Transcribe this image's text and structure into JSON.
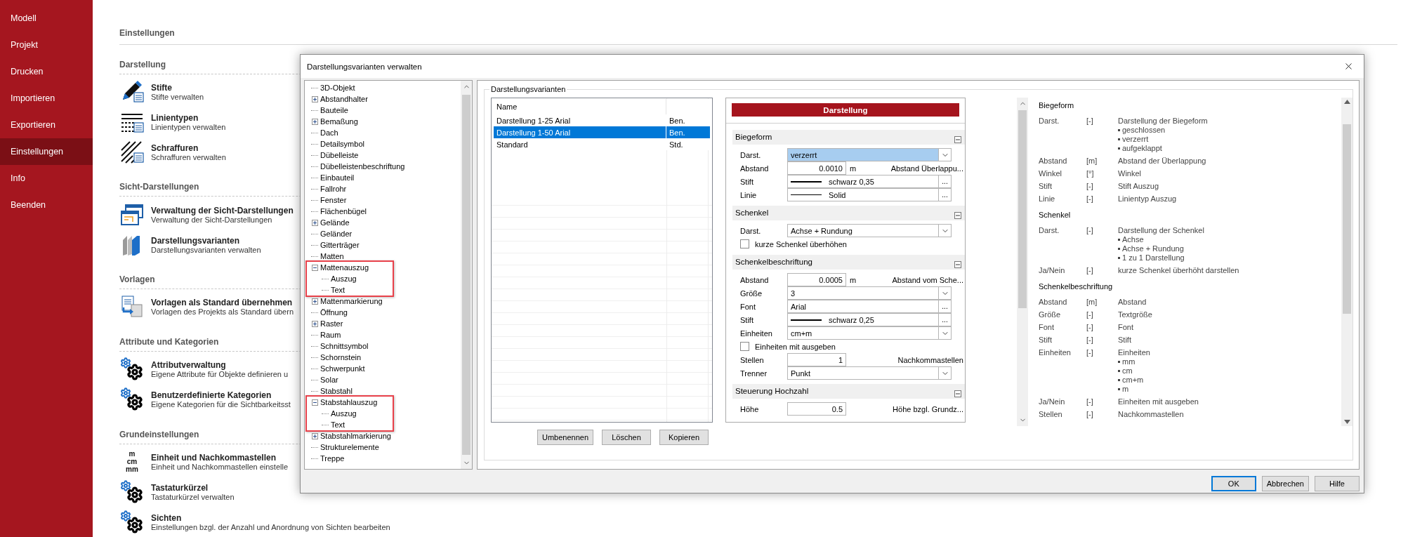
{
  "sidebar": {
    "items": [
      {
        "label": "Modell",
        "selected": false
      },
      {
        "label": "Projekt",
        "selected": false
      },
      {
        "label": "Drucken",
        "selected": false
      },
      {
        "label": "Importieren",
        "selected": false
      },
      {
        "label": "Exportieren",
        "selected": false
      },
      {
        "label": "Einstellungen",
        "selected": true
      },
      {
        "label": "Info",
        "selected": false
      },
      {
        "label": "Beenden",
        "selected": false
      }
    ]
  },
  "settings": {
    "title": "Einstellungen",
    "sections": [
      {
        "title": "Darstellung",
        "items": [
          {
            "kind": "pen",
            "title": "Stifte",
            "subtitle": "Stifte verwalten"
          },
          {
            "kind": "linetypes",
            "title": "Linientypen",
            "subtitle": "Linientypen verwalten"
          },
          {
            "kind": "hatch",
            "title": "Schraffuren",
            "subtitle": "Schraffuren verwalten"
          }
        ]
      },
      {
        "title": "Sicht-Darstellungen",
        "items": [
          {
            "kind": "views",
            "title": "Verwaltung der Sicht-Darstellungen",
            "subtitle": "Verwaltung der Sicht-Darstellungen"
          },
          {
            "kind": "books",
            "title": "Darstellungsvarianten",
            "subtitle": "Darstellungsvarianten verwalten"
          }
        ]
      },
      {
        "title": "Vorlagen",
        "items": [
          {
            "kind": "template",
            "title": "Vorlagen als Standard übernehmen",
            "subtitle": "Vorlagen des Projekts als Standard übern"
          }
        ]
      },
      {
        "title": "Attribute und Kategorien",
        "items": [
          {
            "kind": "gears",
            "title": "Attributverwaltung",
            "subtitle": "Eigene Attribute für Objekte definieren u"
          },
          {
            "kind": "gears",
            "title": "Benutzerdefinierte Kategorien",
            "subtitle": "Eigene Kategorien für die Sichtbarkeitsst"
          }
        ]
      },
      {
        "title": "Grundeinstellungen",
        "items": [
          {
            "kind": "units",
            "icon_lines": [
              "m",
              "cm",
              "mm"
            ],
            "title": "Einheit und Nachkommastellen",
            "subtitle": "Einheit und Nachkommastellen einstelle"
          },
          {
            "kind": "gears",
            "title": "Tastaturkürzel",
            "subtitle": "Tastaturkürzel verwalten"
          },
          {
            "kind": "gears",
            "title": "Sichten",
            "subtitle": "Einstellungen bzgl. der Anzahl und Anordnung von Sichten bearbeiten"
          }
        ]
      }
    ]
  },
  "dialog": {
    "title": "Darstellungsvarianten verwalten",
    "tree": {
      "items": [
        {
          "label": "3D-Objekt",
          "kind": "leaf",
          "highlighted": false
        },
        {
          "label": "Abstandhalter",
          "kind": "group",
          "expanded": false,
          "highlighted": false
        },
        {
          "label": "Bauteile",
          "kind": "leaf",
          "highlighted": false
        },
        {
          "label": "Bemaßung",
          "kind": "group",
          "expanded": false,
          "highlighted": false
        },
        {
          "label": "Dach",
          "kind": "leaf",
          "highlighted": false
        },
        {
          "label": "Detailsymbol",
          "kind": "leaf",
          "highlighted": false
        },
        {
          "label": "Dübelleiste",
          "kind": "leaf",
          "highlighted": false
        },
        {
          "label": "Dübelleistenbeschriftung",
          "kind": "leaf",
          "highlighted": false
        },
        {
          "label": "Einbauteil",
          "kind": "leaf",
          "highlighted": false
        },
        {
          "label": "Fallrohr",
          "kind": "leaf",
          "highlighted": false
        },
        {
          "label": "Fenster",
          "kind": "leaf",
          "highlighted": false
        },
        {
          "label": "Flächenbügel",
          "kind": "leaf",
          "highlighted": false
        },
        {
          "label": "Gelände",
          "kind": "group",
          "expanded": false,
          "highlighted": false
        },
        {
          "label": "Geländer",
          "kind": "leaf",
          "highlighted": false
        },
        {
          "label": "Gitterträger",
          "kind": "leaf",
          "highlighted": false
        },
        {
          "label": "Matten",
          "kind": "leaf",
          "highlighted": false
        },
        {
          "label": "Mattenauszug",
          "kind": "group",
          "expanded": true,
          "highlighted": true,
          "children": [
            {
              "label": "Auszug"
            },
            {
              "label": "Text"
            }
          ]
        },
        {
          "label": "Mattenmarkierung",
          "kind": "group",
          "expanded": false,
          "highlighted": false
        },
        {
          "label": "Öffnung",
          "kind": "leaf",
          "highlighted": false
        },
        {
          "label": "Raster",
          "kind": "group",
          "expanded": false,
          "highlighted": false
        },
        {
          "label": "Raum",
          "kind": "leaf",
          "highlighted": false
        },
        {
          "label": "Schnittsymbol",
          "kind": "leaf",
          "highlighted": false
        },
        {
          "label": "Schornstein",
          "kind": "leaf",
          "highlighted": false
        },
        {
          "label": "Schwerpunkt",
          "kind": "leaf",
          "highlighted": false
        },
        {
          "label": "Solar",
          "kind": "leaf",
          "highlighted": false
        },
        {
          "label": "Stabstahl",
          "kind": "leaf",
          "highlighted": false
        },
        {
          "label": "Stabstahlauszug",
          "kind": "group",
          "expanded": true,
          "highlighted": true,
          "children": [
            {
              "label": "Auszug"
            },
            {
              "label": "Text"
            }
          ]
        },
        {
          "label": "Stabstahlmarkierung",
          "kind": "group",
          "expanded": false,
          "highlighted": false
        },
        {
          "label": "Strukturelemente",
          "kind": "leaf",
          "highlighted": false
        },
        {
          "label": "Treppe",
          "kind": "leaf",
          "highlighted": false
        }
      ]
    },
    "variants": {
      "group_title": "Darstellungsvarianten",
      "columns": [
        "Name"
      ],
      "rows": [
        {
          "name": "Darstellung 1-25 Arial",
          "column_2": "Ben.",
          "selected": false
        },
        {
          "name": "Darstellung 1-50 Arial",
          "column_2": "Ben.",
          "selected": true
        },
        {
          "name": "Standard",
          "column_2": "Std.",
          "selected": false
        }
      ],
      "buttons": [
        "Umbenennen",
        "Löschen",
        "Kopieren"
      ]
    },
    "properties": {
      "header": "Darstellung",
      "sections": [
        {
          "title": "Biegeform",
          "expanded": true,
          "rows": [
            {
              "kind": "select",
              "label": "Darst.",
              "value": "verzerrt",
              "focused": true
            },
            {
              "kind": "number",
              "label": "Abstand",
              "value": "0.0010",
              "unit": "m",
              "note": "Abstand Überlappu..."
            },
            {
              "kind": "pen",
              "label": "Stift",
              "value": "schwarz 0,35",
              "button": "..."
            },
            {
              "kind": "line",
              "label": "Linie",
              "value": "Solid",
              "button": "..."
            }
          ]
        },
        {
          "title": "Schenkel",
          "expanded": true,
          "rows": [
            {
              "kind": "select",
              "label": "Darst.",
              "value": "Achse + Rundung",
              "focused": false
            },
            {
              "kind": "checkbox",
              "label": "kurze Schenkel überhöhen",
              "checked": false
            }
          ]
        },
        {
          "title": "Schenkelbeschriftung",
          "expanded": true,
          "rows": [
            {
              "kind": "number",
              "label": "Abstand",
              "value": "0.0005",
              "unit": "m",
              "note": "Abstand vom Sche..."
            },
            {
              "kind": "select",
              "label": "Größe",
              "value": "3",
              "focused": false
            },
            {
              "kind": "browse",
              "label": "Font",
              "value": "Arial",
              "button": "..."
            },
            {
              "kind": "pen",
              "label": "Stift",
              "value": "schwarz 0,25",
              "button": "..."
            },
            {
              "kind": "select",
              "label": "Einheiten",
              "value": "cm+m",
              "focused": false
            },
            {
              "kind": "checkbox",
              "label": "Einheiten mit ausgeben",
              "checked": false
            },
            {
              "kind": "number",
              "label": "Stellen",
              "value": "1",
              "note": "Nachkommastellen"
            },
            {
              "kind": "select",
              "label": "Trenner",
              "value": "Punkt",
              "focused": false
            }
          ]
        },
        {
          "title": "Steuerung Hochzahl",
          "expanded": true,
          "rows": [
            {
              "kind": "number",
              "label": "Höhe",
              "value": "0.5",
              "note": "Höhe bzgl. Grundz..."
            }
          ]
        }
      ]
    },
    "help": {
      "sections": [
        {
          "title": "Biegeform",
          "rows": [
            {
              "name": "Darst.",
              "unit": "[-]",
              "description": "Darstellung der Biegeform",
              "bullets": [
                "geschlossen",
                "verzerrt",
                "aufgeklappt"
              ]
            },
            {
              "name": "Abstand",
              "unit": "[m]",
              "description": "Abstand der Überlappung"
            },
            {
              "name": "Winkel",
              "unit": "[°]",
              "description": "Winkel"
            },
            {
              "name": "Stift",
              "unit": "[-]",
              "description": "Stift Auszug"
            },
            {
              "name": "Linie",
              "unit": "[-]",
              "description": "Linientyp Auszug"
            }
          ]
        },
        {
          "title": "Schenkel",
          "rows": [
            {
              "name": "Darst.",
              "unit": "[-]",
              "description": "Darstellung der Schenkel",
              "bullets": [
                "Achse",
                "Achse + Rundung",
                "1 zu 1 Darstellung"
              ]
            },
            {
              "name": "Ja/Nein",
              "unit": "[-]",
              "description": "kurze Schenkel überhöht darstellen"
            }
          ]
        },
        {
          "title": "Schenkelbeschriftung",
          "rows": [
            {
              "name": "Abstand",
              "unit": "[m]",
              "description": "Abstand"
            },
            {
              "name": "Größe",
              "unit": "[-]",
              "description": "Textgröße"
            },
            {
              "name": "Font",
              "unit": "[-]",
              "description": "Font"
            },
            {
              "name": "Stift",
              "unit": "[-]",
              "description": "Stift"
            },
            {
              "name": "Einheiten",
              "unit": "[-]",
              "description": "Einheiten",
              "bullets": [
                "mm",
                "cm",
                "cm+m",
                "m"
              ]
            },
            {
              "name": "Ja/Nein",
              "unit": "[-]",
              "description": "Einheiten mit ausgeben"
            },
            {
              "name": "Stellen",
              "unit": "[-]",
              "description": "Nachkommastellen"
            }
          ]
        }
      ]
    },
    "buttons": [
      {
        "label": "OK",
        "default": true
      },
      {
        "label": "Abbrechen",
        "default": false
      },
      {
        "label": "Hilfe",
        "default": false
      }
    ]
  }
}
